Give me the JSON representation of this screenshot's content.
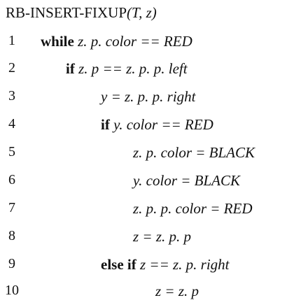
{
  "title": {
    "name": "RB-INSERT-FIXUP",
    "args": "(T, z)"
  },
  "lines": [
    {
      "num": "1",
      "kw": "while",
      "code": " z. p. color == RED"
    },
    {
      "num": "2",
      "kw": "if",
      "code": " z. p == z. p. p. left"
    },
    {
      "num": "3",
      "kw": "",
      "code": "y = z. p. p. right"
    },
    {
      "num": "4",
      "kw": "if",
      "code": " y. color == RED"
    },
    {
      "num": "5",
      "kw": "",
      "code": "z. p. color = BLACK"
    },
    {
      "num": "6",
      "kw": "",
      "code": "y. color = BLACK"
    },
    {
      "num": "7",
      "kw": "",
      "code": "z. p. p. color = RED"
    },
    {
      "num": "8",
      "kw": "",
      "code": "z = z. p. p"
    },
    {
      "num": "9",
      "kw": "else if",
      "code": " z == z. p. right"
    },
    {
      "num": "10",
      "kw": "",
      "code": "z = z. p"
    }
  ]
}
